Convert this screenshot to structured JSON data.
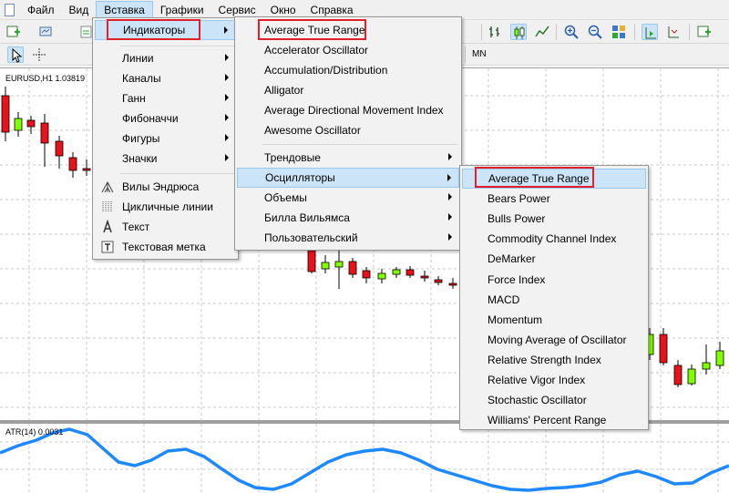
{
  "menubar": {
    "items": [
      "Файл",
      "Вид",
      "Вставка",
      "Графики",
      "Сервис",
      "Окно",
      "Справка"
    ],
    "active_index": 2
  },
  "toolbar": {
    "timeframe_label": "MN"
  },
  "chart": {
    "symbol_label": "EURUSD,H1  1.03819",
    "indicator_label": "ATR(14) 0.0031",
    "colors": {
      "bull": "#7fff00",
      "bear": "#e8121a",
      "atr_line": "#1e88ff",
      "grid": "#c8c8c8"
    }
  },
  "insert_menu": {
    "items": [
      {
        "label": "Индикаторы",
        "submenu": true,
        "highlight": true
      },
      {
        "label": "Линии",
        "submenu": true
      },
      {
        "label": "Каналы",
        "submenu": true
      },
      {
        "label": "Ганн",
        "submenu": true
      },
      {
        "label": "Фибоначчи",
        "submenu": true
      },
      {
        "label": "Фигуры",
        "submenu": true
      },
      {
        "label": "Значки",
        "submenu": true
      },
      {
        "label": "Вилы Эндрюса",
        "icon": "andrews-pitchfork-icon"
      },
      {
        "label": "Цикличные линии",
        "icon": "cycle-lines-icon"
      },
      {
        "label": "Текст",
        "icon": "text-icon"
      },
      {
        "label": "Текстовая метка",
        "icon": "text-label-icon"
      }
    ]
  },
  "indicators_menu": {
    "items": [
      "Average True Range",
      "Accelerator Oscillator",
      "Accumulation/Distribution",
      "Alligator",
      "Average Directional Movement Index",
      "Awesome Oscillator"
    ],
    "groups": [
      {
        "label": "Трендовые",
        "submenu": true
      },
      {
        "label": "Осцилляторы",
        "submenu": true,
        "highlight": true
      },
      {
        "label": "Объемы",
        "submenu": true
      },
      {
        "label": "Билла Вильямса",
        "submenu": true
      },
      {
        "label": "Пользовательский",
        "submenu": true
      }
    ]
  },
  "oscillators_menu": {
    "items": [
      "Average True Range",
      "Bears Power",
      "Bulls Power",
      "Commodity Channel Index",
      "DeMarker",
      "Force Index",
      "MACD",
      "Momentum",
      "Moving Average of Oscillator",
      "Relative Strength Index",
      "Relative Vigor Index",
      "Stochastic Oscillator",
      "Williams' Percent Range"
    ]
  }
}
